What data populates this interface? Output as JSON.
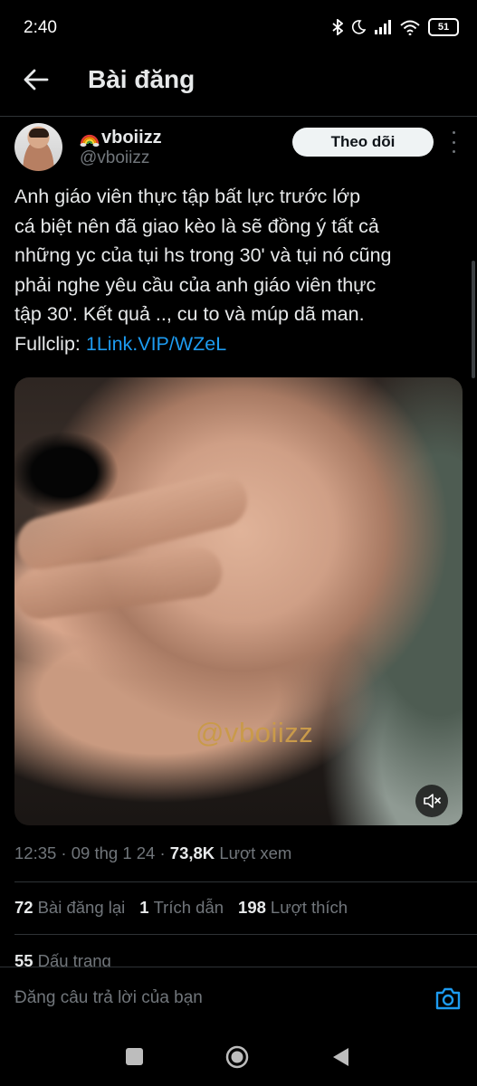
{
  "status_bar": {
    "time": "2:40",
    "battery": "51"
  },
  "header": {
    "title": "Bài đăng"
  },
  "author": {
    "display_name": "vboiizz",
    "handle": "@vboiizz",
    "follow_label": "Theo dõi"
  },
  "tweet": {
    "lines": [
      "Anh giáo viên thực tập bất lực trước lớp",
      "cá biệt nên đã giao kèo là sẽ đồng ý tất cả",
      "những yc của tụi hs trong 30' và tụi nó cũng",
      "phải nghe yêu cầu của anh giáo viên thực",
      "tập 30'. Kết quả .., cu to và múp dã man."
    ],
    "fullclip_label": "Fullclip:",
    "link": "1Link.VIP/WZeL"
  },
  "media": {
    "watermark": "@vboiizz"
  },
  "meta": {
    "time": "12:35",
    "date": "09 thg 1 24",
    "views": "73,8K",
    "views_label": "Lượt xem"
  },
  "stats": {
    "reposts": "72",
    "reposts_label": "Bài đăng lại",
    "quotes": "1",
    "quotes_label": "Trích dẫn",
    "likes": "198",
    "likes_label": "Lượt thích",
    "bookmarks": "55",
    "bookmarks_label": "Dấu trang"
  },
  "reply": {
    "placeholder": "Đăng câu trả lời của bạn"
  },
  "colors": {
    "background": "#000000",
    "text": "#e7e9ea",
    "muted": "#71767b",
    "link": "#1d9bf0",
    "follow_button": "#eff3f4"
  }
}
